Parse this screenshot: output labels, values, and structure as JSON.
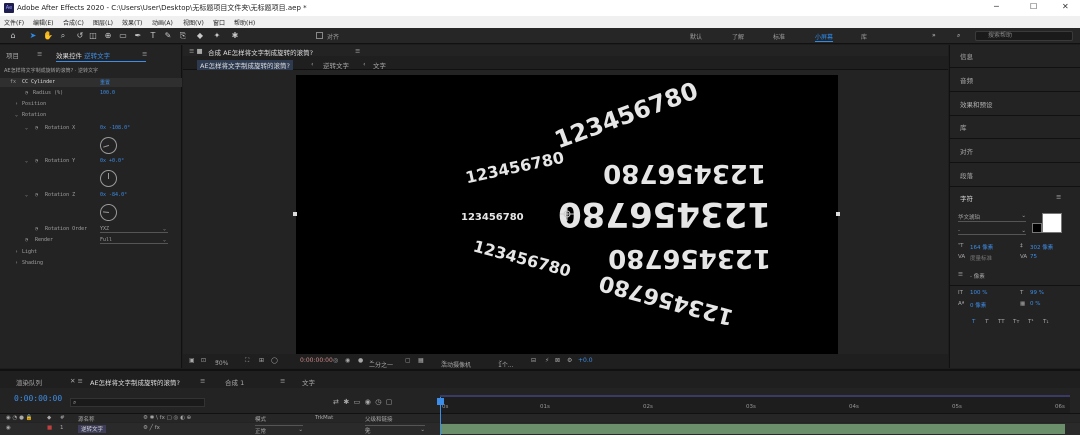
{
  "window": {
    "title": "Adobe After Effects 2020 - C:\\Users\\User\\Desktop\\无标题项目文件夹\\无标题项目.aep *"
  },
  "menu": [
    "文件(F)",
    "编辑(E)",
    "合成(C)",
    "图层(L)",
    "效果(T)",
    "动画(A)",
    "视图(V)",
    "窗口",
    "帮助(H)"
  ],
  "toolbar": {
    "align_label": "对齐",
    "workspaces": [
      "默认",
      "了解",
      "标准",
      "小屏幕",
      "库"
    ],
    "active_workspace": "小屏幕",
    "search_placeholder": "搜索帮助"
  },
  "left_panel": {
    "tab_project": "项目",
    "tab_effects_prefix": "效果控件",
    "tab_effects_layer": "逆转文字",
    "breadcrumb": "AE怎样将文字制成旋转的滚筒? · 逆转文字",
    "effect": {
      "fx": "fx",
      "name": "CC Cylinder",
      "reset": "重置",
      "radius_label": "Radius (%)",
      "radius_value": "100.0",
      "position_label": "Position",
      "rotation_label": "Rotation",
      "rotation_x_label": "Rotation X",
      "rotation_x_value": "0x -108.0°",
      "rotation_y_label": "Rotation Y",
      "rotation_y_value": "0x +0.0°",
      "rotation_z_label": "Rotation Z",
      "rotation_z_value": "0x -84.0°",
      "rotation_order_label": "Rotation Order",
      "rotation_order_value": "YXZ",
      "render_label": "Render",
      "render_value": "Full",
      "light_label": "Light",
      "shading_label": "Shading"
    }
  },
  "composition": {
    "panel_title": "合成 AE怎样将文字制成旋转的滚筒?",
    "active_tab": "AE怎样将文字制成旋转的滚筒?",
    "nav": [
      "逆转文字",
      "文字"
    ],
    "canvas_text": "123456780",
    "viewer_bar": {
      "zoom": "50%",
      "timecode": "0:00:00:00",
      "resolution": "二分之一",
      "camera": "活动摄像机",
      "views": "1个...",
      "exposure": "+0.0"
    }
  },
  "right_panel": {
    "items": [
      "信息",
      "音频",
      "效果和预设",
      "库",
      "对齐",
      "段落"
    ],
    "character": {
      "title": "字符",
      "font": "华文琥珀",
      "style": "-",
      "size": "164 像素",
      "leading": "302 像素",
      "kerning": "度量标准",
      "tracking": "75",
      "stroke": "- 像素",
      "vscale": "100 %",
      "hscale": "99 %",
      "baseline": "0 像素",
      "tsume": "0 %",
      "styles": [
        "T",
        "T",
        "TT",
        "Tт",
        "T¹",
        "T₁"
      ]
    }
  },
  "timeline": {
    "tabs": [
      "渲染队列",
      "AE怎样将文字制成旋转的滚筒?",
      "合成 1",
      "文字"
    ],
    "timecode": "0:00:00:00",
    "ruler": [
      "0s",
      "01s",
      "02s",
      "03s",
      "04s",
      "05s",
      "06s"
    ],
    "columns": {
      "name": "源名称",
      "mode": "模式",
      "trkmat": "TrkMat",
      "parent": "父级和链接"
    },
    "layer": {
      "index": "1",
      "name": "逆转文字",
      "mode": "正常",
      "parent": "无"
    }
  }
}
